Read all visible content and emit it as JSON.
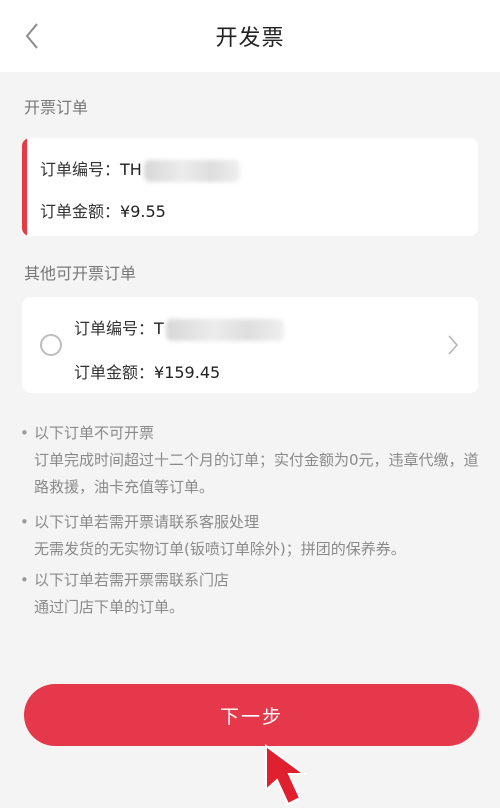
{
  "header": {
    "title": "开发票"
  },
  "current": {
    "label": "开票订单",
    "order_no_label": "订单编号：",
    "order_no_value": "TH",
    "amount_label": "订单金额：",
    "amount_value": "¥9.55"
  },
  "others": {
    "label": "其他可开票订单",
    "items": [
      {
        "order_no_label": "订单编号：",
        "order_no_value": "T",
        "amount_label": "订单金额：",
        "amount_value": "¥159.45"
      }
    ]
  },
  "notes": [
    {
      "title": "以下订单不可开票",
      "body": "订单完成时间超过十二个月的订单；实付金额为0元，违章代缴，道路救援，油卡充值等订单。"
    },
    {
      "title": "以下订单若需开票请联系客服处理",
      "body": "无需发货的无实物订单(钣喷订单除外)；拼团的保养券。"
    },
    {
      "title": "以下订单若需开票需联系门店",
      "body": "通过门店下单的订单。"
    }
  ],
  "actions": {
    "next_label": "下一步"
  },
  "colors": {
    "accent": "#e5394b",
    "background": "#f4f4f4"
  }
}
